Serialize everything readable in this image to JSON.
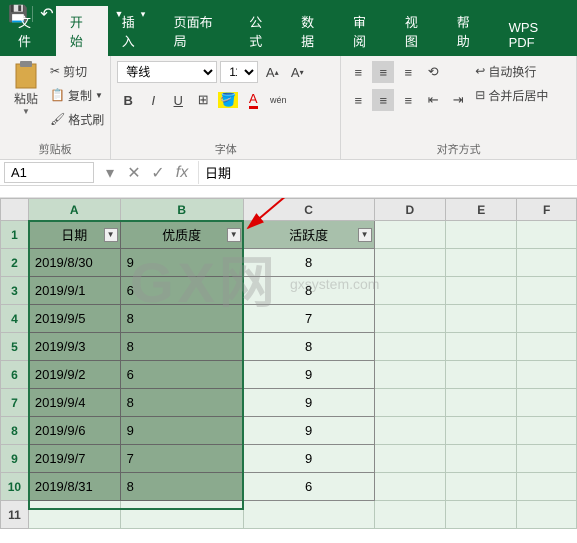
{
  "qat": {
    "save": "💾",
    "undo": "↶",
    "redo": "↷"
  },
  "tabs": [
    "文件",
    "开始",
    "插入",
    "页面布局",
    "公式",
    "数据",
    "审阅",
    "视图",
    "帮助",
    "WPS PDF"
  ],
  "active_tab": 1,
  "ribbon": {
    "clipboard": {
      "paste": "粘贴",
      "cut": "剪切",
      "copy": "复制",
      "format_painter": "格式刷",
      "label": "剪贴板"
    },
    "font": {
      "name": "等线",
      "size": "11",
      "label": "字体"
    },
    "align": {
      "wrap": "自动换行",
      "merge": "合并后居中",
      "label": "对齐方式"
    }
  },
  "formula_bar": {
    "name_box": "A1",
    "value": "日期"
  },
  "columns": [
    "A",
    "B",
    "C",
    "D",
    "E",
    "F"
  ],
  "headers": [
    "日期",
    "优质度",
    "活跃度"
  ],
  "rows": [
    {
      "date": "2019/8/30",
      "quality": "9",
      "activity": "8"
    },
    {
      "date": "2019/9/1",
      "quality": "6",
      "activity": "8"
    },
    {
      "date": "2019/9/5",
      "quality": "8",
      "activity": "7"
    },
    {
      "date": "2019/9/3",
      "quality": "8",
      "activity": "8"
    },
    {
      "date": "2019/9/2",
      "quality": "6",
      "activity": "9"
    },
    {
      "date": "2019/9/4",
      "quality": "8",
      "activity": "9"
    },
    {
      "date": "2019/9/6",
      "quality": "9",
      "activity": "9"
    },
    {
      "date": "2019/9/7",
      "quality": "7",
      "activity": "9"
    },
    {
      "date": "2019/8/31",
      "quality": "8",
      "activity": "6"
    }
  ],
  "watermark": "GX网",
  "watermark_sub": "gxsystem.com",
  "chart_data": {
    "type": "table",
    "title": "",
    "columns": [
      "日期",
      "优质度",
      "活跃度"
    ],
    "data": [
      [
        "2019/8/30",
        9,
        8
      ],
      [
        "2019/9/1",
        6,
        8
      ],
      [
        "2019/9/5",
        8,
        7
      ],
      [
        "2019/9/3",
        8,
        8
      ],
      [
        "2019/9/2",
        6,
        9
      ],
      [
        "2019/9/4",
        8,
        9
      ],
      [
        "2019/9/6",
        9,
        9
      ],
      [
        "2019/9/7",
        7,
        9
      ],
      [
        "2019/8/31",
        8,
        6
      ]
    ]
  }
}
